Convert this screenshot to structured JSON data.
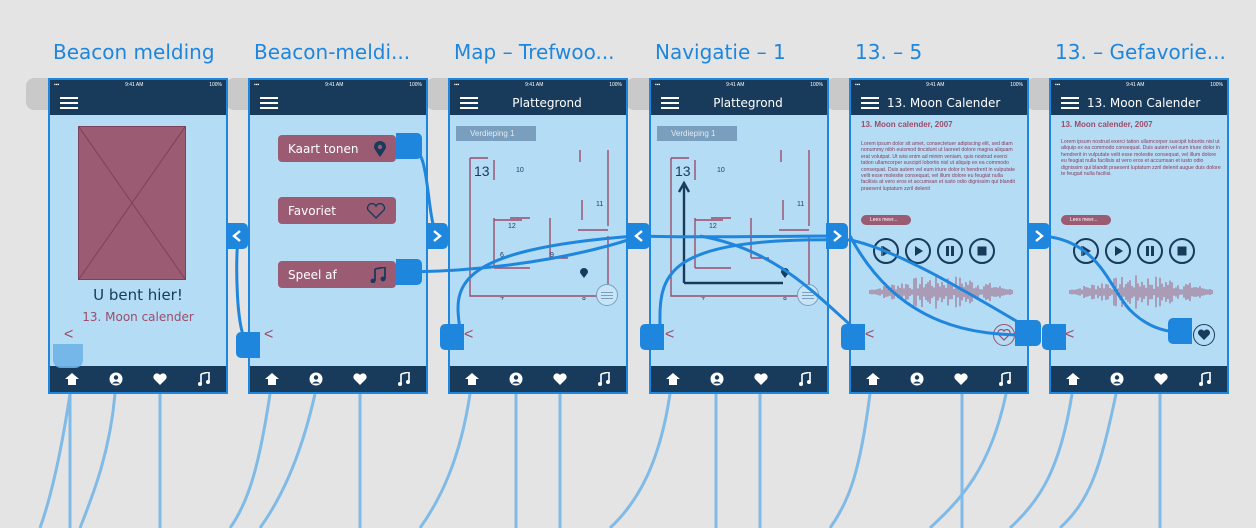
{
  "artboards": [
    {
      "title": "Beacon melding"
    },
    {
      "title": "Beacon-meldi..."
    },
    {
      "title": "Map – Trefwoo..."
    },
    {
      "title": "Navigatie – 1"
    },
    {
      "title": "13. – 5"
    },
    {
      "title": "13. – Gefavorie..."
    }
  ],
  "status": {
    "time": "9:41 AM",
    "battery": "100%"
  },
  "beacon": {
    "here": "U bent hier!",
    "exhibit": "13. Moon calender"
  },
  "actions": {
    "map": "Kaart tonen",
    "favorite": "Favoriet",
    "play": "Speel af"
  },
  "map": {
    "appbar": "Plattegrond",
    "level": "Verdieping 1",
    "rooms": [
      "13",
      "10",
      "11",
      "12",
      "6",
      "9",
      "7",
      "8"
    ]
  },
  "article": {
    "appbar": "13. Moon Calender",
    "title": "13. Moon calender, 2007",
    "body_a": "Lorem ipsum dolor sit amet, consectetuer adipiscing elit, sed diam nonummy nibh euismod tincidunt ut laoreet dolore magna aliquam erat volutpat. Ut wisi enim ad minim veniam, quis nostrud exerci tation ullamcorper suscipit lobortis nisl ut aliquip ex ea commodo consequat. Duis autem vel eum iriure dolor in hendrerit in vulputate velit esse molestie consequat, vel illum dolore eu feugiat nulla facilisis at vero eros et accumsan et iusto odio dignissim qui blandit praesent luptatum zzril delenit",
    "body_b": "Lorem ipsum nostrud exerci tation ullamcorper suscipit lobortis nisl ut aliquip ex ea commodo consequat. Duis autem vel eum iriure dolor in hendrerit in vulputate velit esse molestie consequat, vel illum dolore eu feugiat nulla facilisis at vero eros et accumsan et iusto odio dignissim qui blandit praesent luptatum zzril delenit augue duis dolore te feugait nulla facilisi.",
    "more": "Lees meer..."
  },
  "colors": {
    "accent": "#1f86dd",
    "navy": "#183b5c",
    "mauve": "#9b5b72",
    "screen": "#b5dcf5"
  }
}
